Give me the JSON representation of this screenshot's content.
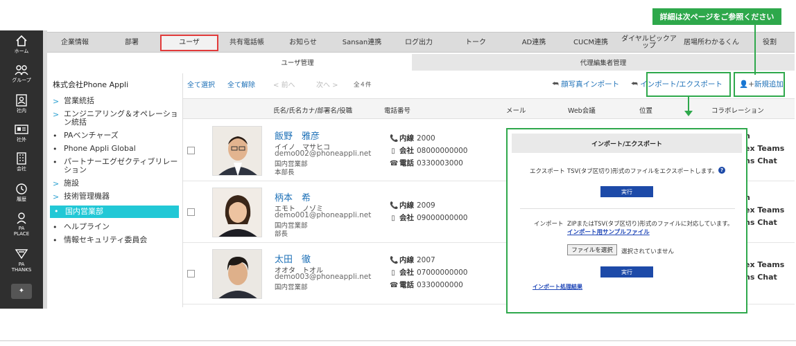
{
  "rail": {
    "home": "ホーム",
    "group": "グループ",
    "internal": "社内",
    "external": "社外",
    "company": "会社",
    "history": "履歴",
    "pa_place_1": "PA",
    "pa_place_2": "PLACE",
    "pa_thanks_1": "PA",
    "pa_thanks_2": "THANKS"
  },
  "topnav": {
    "tabs": [
      "企業情報",
      "部署",
      "ユーザ",
      "共有電話帳",
      "お知らせ",
      "Sansan連携",
      "ログ出力",
      "トーク",
      "AD連携",
      "CUCM連携",
      "ダイヤルピックア ップ",
      "居場所わかるくん",
      "役割"
    ]
  },
  "subtabs": {
    "user_mgmt": "ユーザ管理",
    "proxy_editor": "代理編集者管理"
  },
  "tree": {
    "company": "株式会社Phone Appli",
    "items": [
      "営業統括",
      "エンジニアリング＆オペレーション統括",
      "PAベンチャーズ",
      "Phone Appli Global",
      "パートナーエグゼクティブリレーション",
      "施設",
      "技術管理機器",
      "国内営業部",
      "ヘルプライン",
      "情報セキュリティ委員会"
    ]
  },
  "toolbar": {
    "select_all": "全て選択",
    "deselect_all": "全て解除",
    "prev": "前へ",
    "next": "次へ",
    "count": "全４件",
    "face_import": "顔写真インポート",
    "import_export": "インポート/エクスポート",
    "new_add": "新規追加"
  },
  "columns": {
    "name": "氏名/氏名カナ/部署名/役職",
    "phone": "電話番号",
    "mail": "メール",
    "web": "Web会議",
    "location": "位置",
    "collab": "コラボレーション"
  },
  "users": [
    {
      "name": "飯野　雅彦",
      "kana": "イイノ　マサヒコ",
      "mail": "demo002@phoneappli.net",
      "dept": "国内営業部",
      "title": "本部長",
      "ext": "2000",
      "company": "08000000000",
      "tel": "0330003000",
      "collab1": "n",
      "collab2": "ex Teams",
      "collab3": "ns Chat"
    },
    {
      "name": "柄本　希",
      "kana": "エモト　ノゾミ",
      "mail": "demo001@phoneappli.net",
      "dept": "国内営業部",
      "title": "部長",
      "ext": "2009",
      "company": "09000000000",
      "tel": "",
      "collab1": "n",
      "collab2": "ex Teams",
      "collab3": "ns Chat"
    },
    {
      "name": "太田　徹",
      "kana": "オオタ　トオル",
      "mail": "demo003@phoneappli.net",
      "dept": "国内営業部",
      "title": "",
      "ext": "2007",
      "company": "07000000000",
      "tel": "0330000000",
      "collab1": "",
      "collab2": "ex Teams",
      "collab3": "ns Chat"
    }
  ],
  "phone_labels": {
    "ext": "内線",
    "company": "会社",
    "tel": "電話"
  },
  "callout": {
    "note": "詳細は次ページをご参照ください"
  },
  "dialog": {
    "title": "インポート/エクスポート",
    "export_label": "エクスポート",
    "export_desc": "TSV(タブ区切り)形式のファイルをエクスポートします。",
    "run": "実行",
    "import_label": "インポート",
    "import_desc": "ZIPまたはTSV(タブ区切り)形式のファイルに対応しています。",
    "sample_link": "インポート用サンプルファイル",
    "choose_file": "ファイルを選択",
    "no_file": "選択されていません",
    "result_link": "インポート処理結果"
  },
  "colors": {
    "accent": "#2ea84b",
    "selected": "#22c8d6",
    "link": "#1d70b7",
    "button": "#1d4aa8",
    "active_tab_border": "#e23a3a"
  }
}
